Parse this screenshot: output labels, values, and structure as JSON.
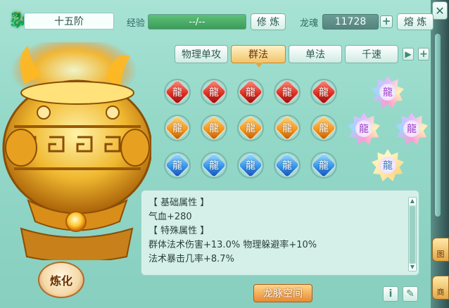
{
  "header": {
    "rank": "十五阶",
    "exp_label": "经验",
    "exp_value": "--/--",
    "cultivate_label": "修 炼",
    "soul_label": "龙魂",
    "soul_value": "11728",
    "smelt_label": "熔 炼"
  },
  "tabs": [
    {
      "label": "物理单攻",
      "active": false
    },
    {
      "label": "群法",
      "active": true
    },
    {
      "label": "单法",
      "active": false
    },
    {
      "label": "千速",
      "active": false
    }
  ],
  "gem_rows": [
    {
      "color": "red",
      "count": 5,
      "glyph": "龍"
    },
    {
      "color": "orange",
      "count": 5,
      "glyph": "龍"
    },
    {
      "color": "blue",
      "count": 5,
      "glyph": "龍"
    }
  ],
  "info": {
    "lines": [
      "【 基础属性 】",
      "气血+280",
      "【 特殊属性 】",
      "群体法术伤害+13.0%  物理躲避率+10%",
      "法术暴击几率+8.7%"
    ]
  },
  "bottom": {
    "refine_label": "炼化",
    "space_label": "龙脉空间"
  },
  "side": {
    "tab1": "图",
    "tab2": "商"
  },
  "icons": [
    "dragon-icon",
    "plus-icon",
    "play-arrow-icon",
    "info-icon",
    "edit-icon",
    "close-icon"
  ]
}
